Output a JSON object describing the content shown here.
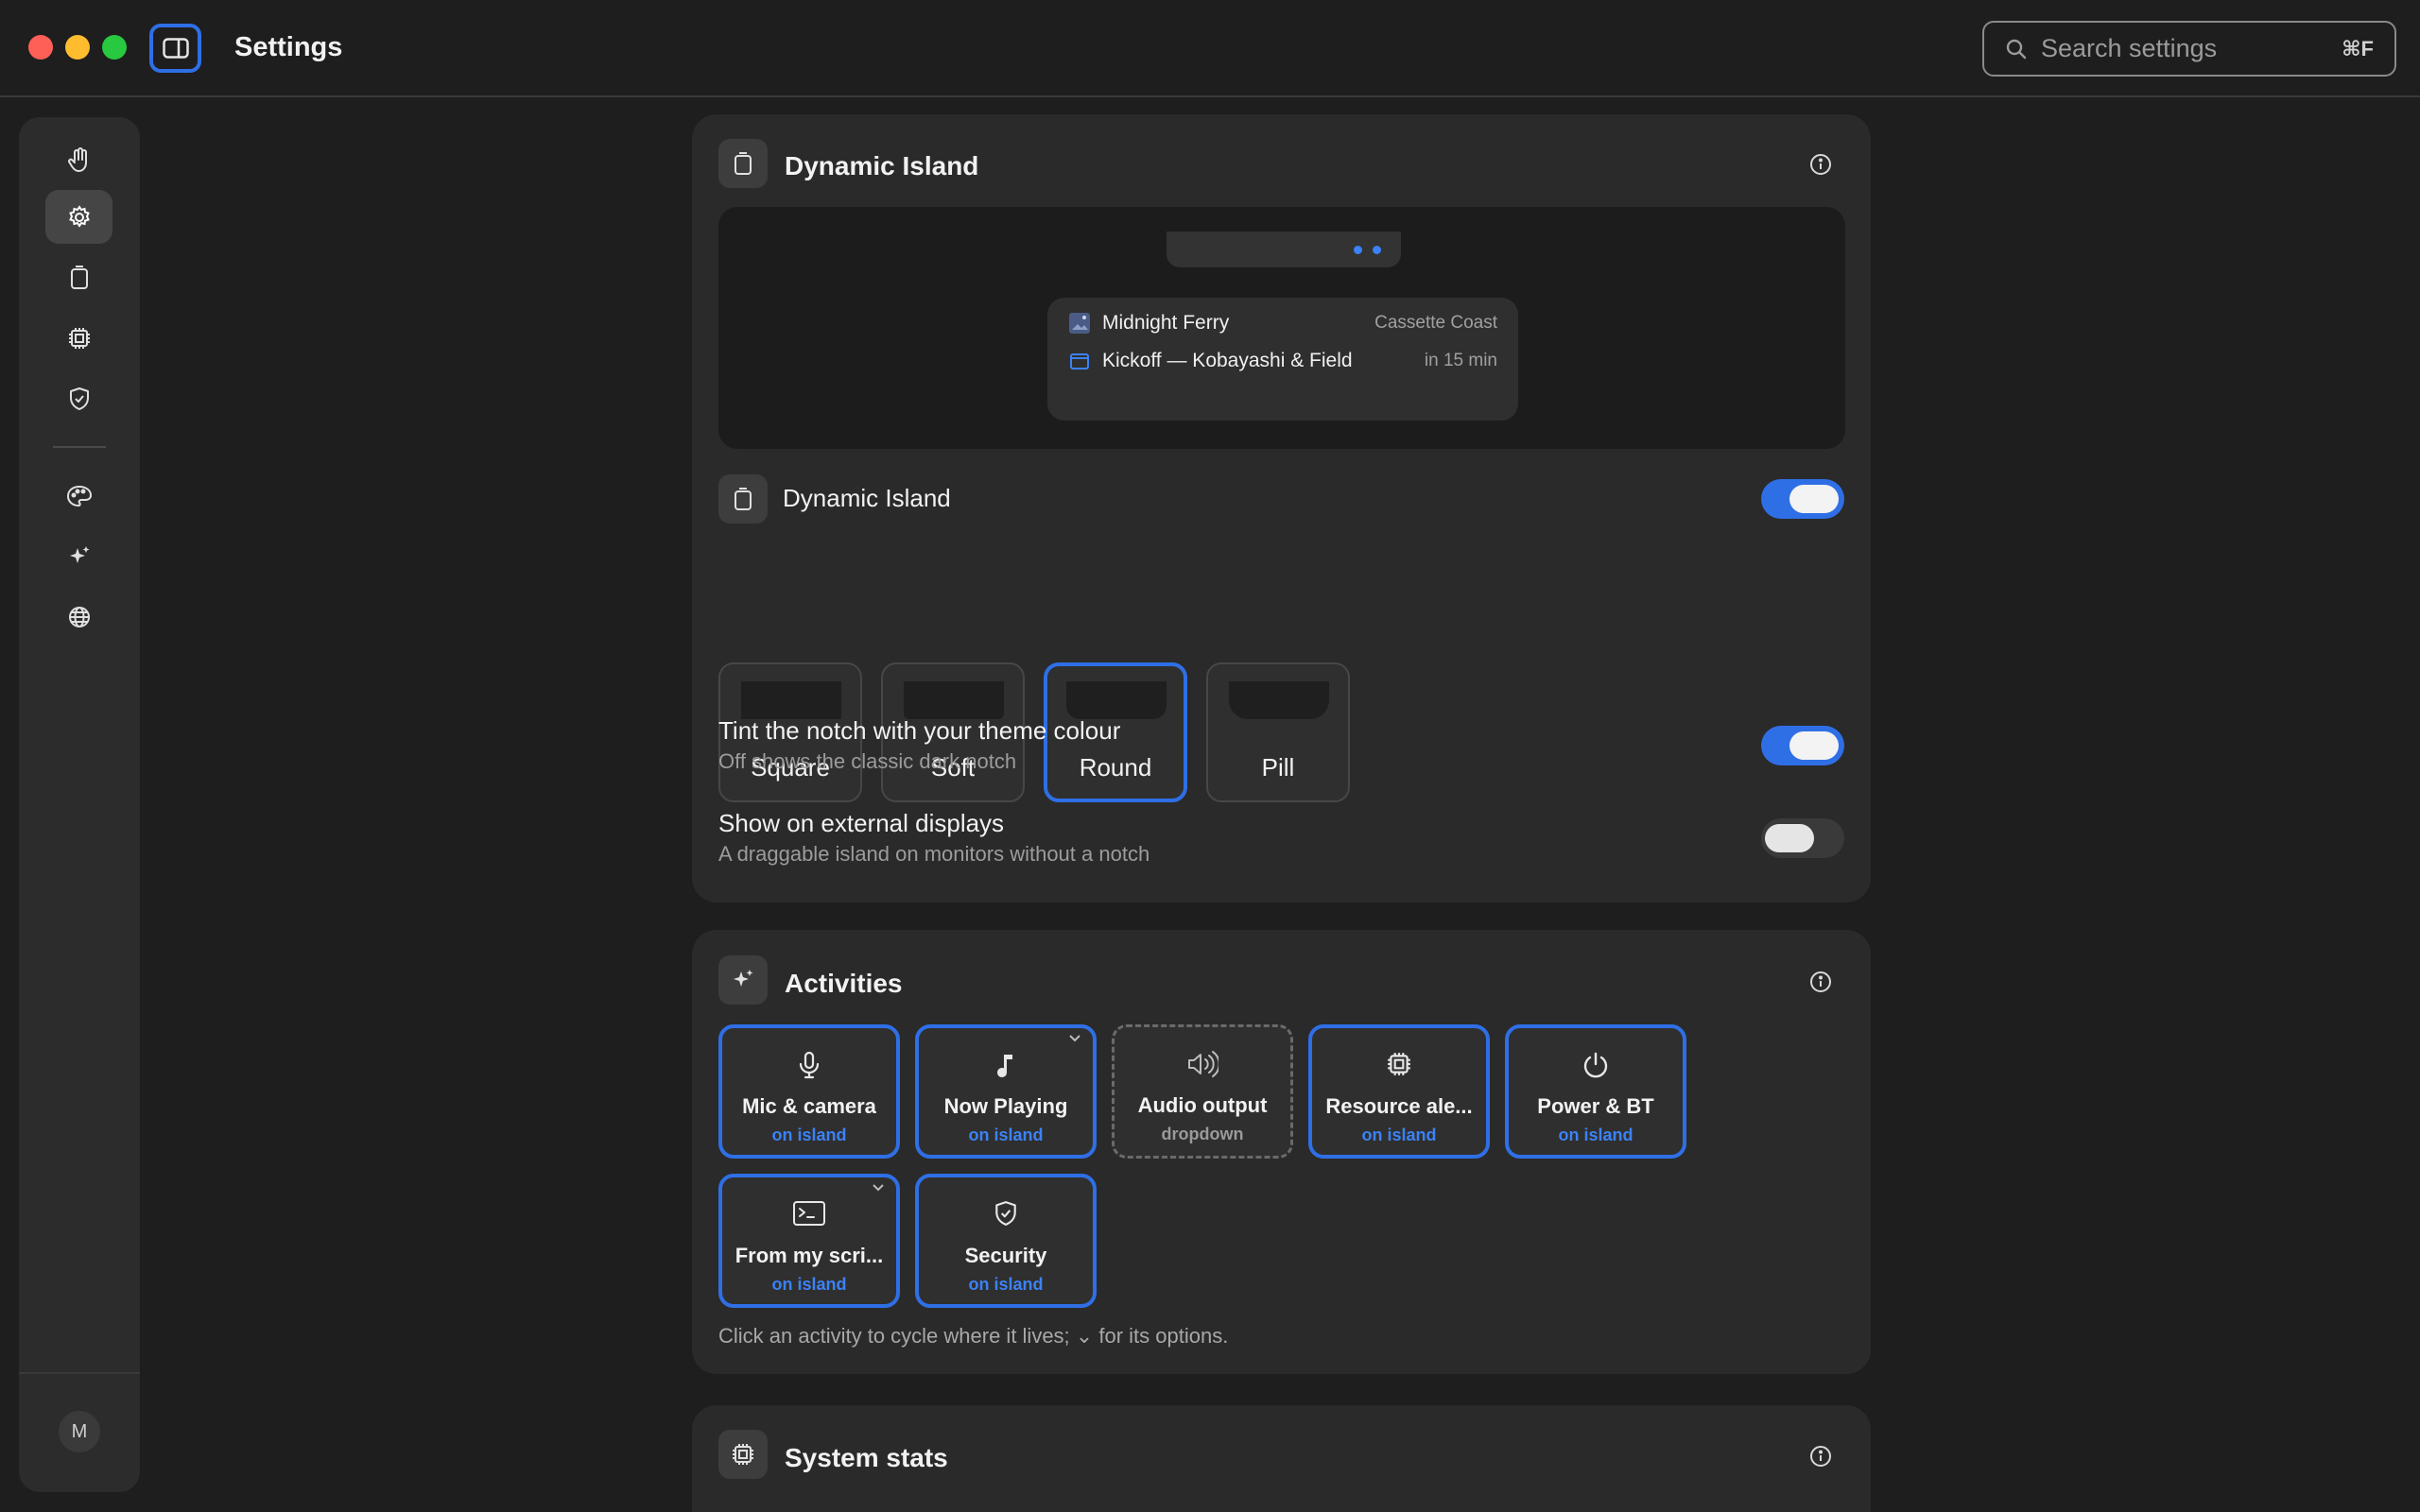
{
  "window": {
    "title": "Settings",
    "search": {
      "placeholder": "Search settings",
      "shortcut": "⌘F"
    }
  },
  "sidebar": {
    "items": [
      {
        "icon": "hand-icon"
      },
      {
        "icon": "gear-icon",
        "active": true
      },
      {
        "icon": "island-icon"
      },
      {
        "icon": "chip-icon"
      },
      {
        "icon": "shield-icon"
      },
      {
        "icon": "palette-icon"
      },
      {
        "icon": "sparkle-icon"
      },
      {
        "icon": "globe-icon"
      }
    ],
    "avatar": "M"
  },
  "dynamic_island_card": {
    "title": "Dynamic Island",
    "preview": {
      "rows": [
        {
          "main": "Midnight Ferry",
          "meta": "Cassette Coast"
        },
        {
          "main": "Kickoff — Kobayashi & Field",
          "meta": "in 15 min"
        }
      ]
    },
    "toggle_row": {
      "label": "Dynamic Island",
      "on": true
    },
    "shapes": [
      {
        "label": "Square"
      },
      {
        "label": "Soft"
      },
      {
        "label": "Round",
        "selected": true
      },
      {
        "label": "Pill"
      }
    ],
    "tint": {
      "label": "Tint the notch with your theme colour",
      "sub": "Off shows the classic dark notch",
      "on": true
    },
    "external": {
      "label": "Show on external displays",
      "sub": "A draggable island on monitors without a notch",
      "on": false
    }
  },
  "activities_card": {
    "title": "Activities",
    "items": [
      {
        "name": "Mic & camera",
        "state": "on island",
        "icon": "mic-icon"
      },
      {
        "name": "Now Playing",
        "state": "on island",
        "icon": "music-note-icon",
        "has_options": true
      },
      {
        "name": "Audio output",
        "state": "dropdown",
        "icon": "speaker-icon"
      },
      {
        "name": "Resource ale...",
        "state": "on island",
        "icon": "chip-icon"
      },
      {
        "name": "Power & BT",
        "state": "on island",
        "icon": "power-icon"
      },
      {
        "name": "From my scri...",
        "state": "on island",
        "icon": "terminal-icon",
        "has_options": true
      },
      {
        "name": "Security",
        "state": "on island",
        "icon": "shield-icon"
      }
    ],
    "hint_before": "Click an activity to cycle where it lives;",
    "hint_glyph": "⌄",
    "hint_after": "for its options."
  },
  "system_stats_card": {
    "title": "System stats"
  },
  "colors": {
    "accent": "#2f6fe6",
    "accent_text": "#3b82f6",
    "background": "#1e1e1e",
    "card": "#2a2a2a"
  }
}
